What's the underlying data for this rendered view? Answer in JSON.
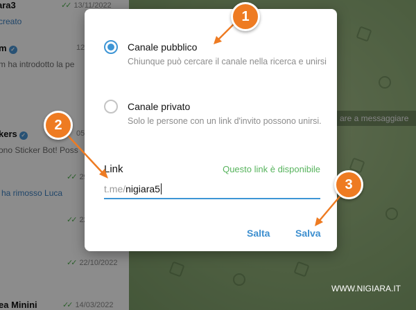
{
  "chat_list": {
    "items": [
      {
        "name": "ara3",
        "date": "13/11/2022",
        "preview": "creato",
        "preview_style": "link"
      },
      {
        "name": "m",
        "verified": true,
        "date": "12",
        "preview": "m ha introdotto la pe"
      },
      {
        "name": "kers",
        "verified": true,
        "date": "05",
        "preview": "ono Sticker Bot! Poss"
      },
      {
        "name": "",
        "date": "29",
        "preview": "ha rimosso Luca",
        "preview_style": "link"
      },
      {
        "name": "",
        "date": "22",
        "preview": ""
      },
      {
        "name": "",
        "date": "22/10/2022",
        "preview": ""
      },
      {
        "name": "ea Minini",
        "date": "14/03/2022",
        "preview": ""
      }
    ]
  },
  "chat_area": {
    "hint": "are a messaggiare",
    "watermark": "WWW.NIGIARA.IT"
  },
  "dialog": {
    "options": [
      {
        "title": "Canale pubblico",
        "description": "Chiunque può cercare il canale nella ricerca e unirsi",
        "selected": true
      },
      {
        "title": "Canale privato",
        "description": "Solo le persone con un link d'invito possono unirsi.",
        "selected": false
      }
    ],
    "link": {
      "label": "Link",
      "status": "Questo link è disponibile",
      "prefix": "t.me/",
      "value": "nigiara5"
    },
    "buttons": {
      "cancel": "Salta",
      "save": "Salva"
    }
  },
  "annotations": {
    "markers": [
      "1",
      "2",
      "3"
    ],
    "color": "#ee7b22"
  },
  "colors": {
    "accent": "#3d95d5",
    "available": "#56b35c"
  }
}
